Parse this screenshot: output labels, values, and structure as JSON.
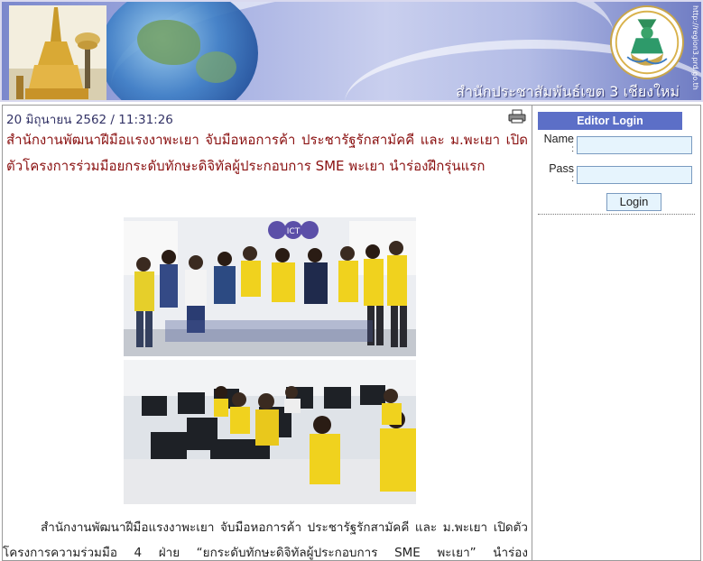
{
  "banner": {
    "office_title": "สำนักประชาสัมพันธ์เขต 3 เชียงใหม่",
    "site_url": "http://region3.prd.go.th"
  },
  "article": {
    "datetime": "20 มิถุนายน 2562 / 11:31:26",
    "headline": "สำนักงานพัฒนาฝีมือแรงงาพะเยา จับมือหอการค้า ประชารัฐรักสามัคคี และ ม.พะเยา เปิดตัวโครงการร่วมมือยกระดับทักษะดิจิทัลผู้ประกอบการ SME พะเยา นำร่องฝึกรุ่นแรก",
    "photo1_sign": "ICT",
    "body_line1": "สำนักงานพัฒนาฝีมือแรงงาพะเยา จับมือหอการค้า ประชารัฐรักสามัคคี และ ม.พะเยา เปิดตัว",
    "body_line2": "โครงการความร่วมมือ 4 ฝ่าย “ยกระดับทักษะดิจิทัลผู้ประกอบการ SME พะเยา” นำร่อง"
  },
  "sidebar": {
    "login_title": "Editor Login",
    "name_label": "Name",
    "pass_label": "Pass",
    "colon": ":",
    "login_button": "Login"
  },
  "colors": {
    "headline": "#8a1010",
    "login_header": "#5c6fc7",
    "field_bg": "#e6f4fd"
  },
  "icons": [
    "print-icon",
    "emblem-icon",
    "pagoda-icon"
  ]
}
